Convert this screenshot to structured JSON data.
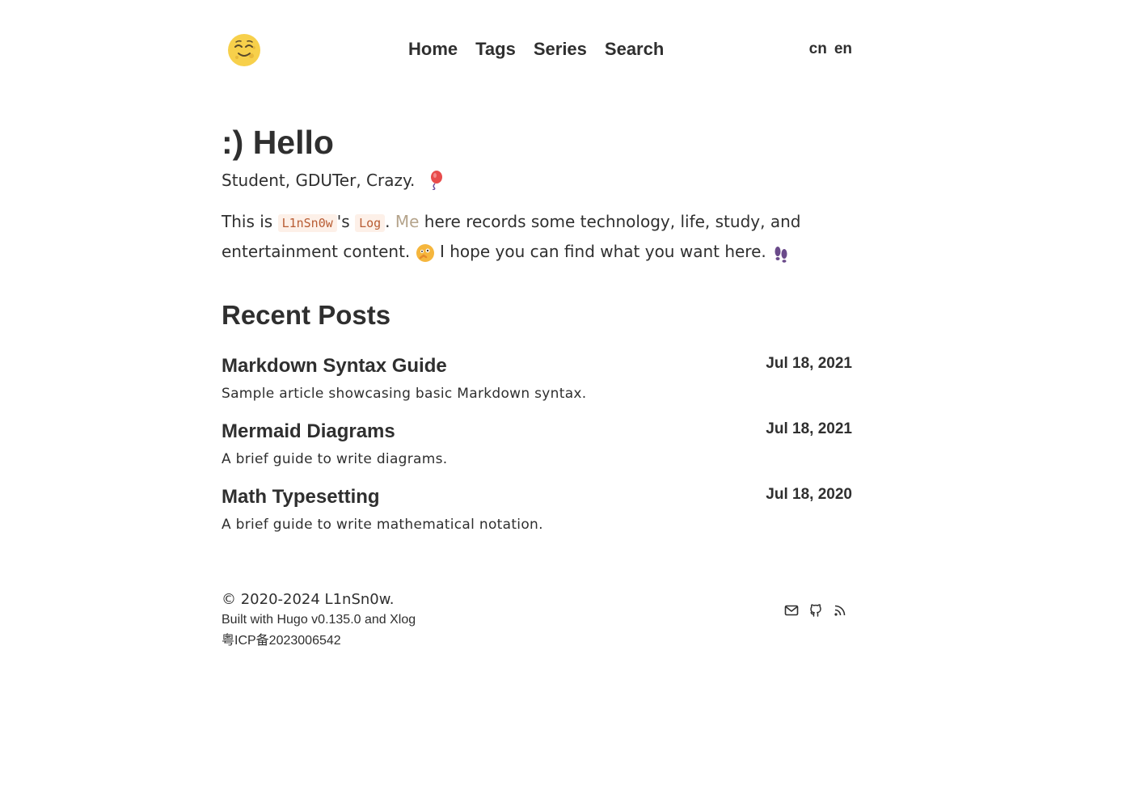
{
  "header": {
    "nav": [
      "Home",
      "Tags",
      "Series",
      "Search"
    ],
    "languages": [
      "cn",
      "en"
    ]
  },
  "hero": {
    "title": ":) Hello",
    "subtitle": "Student, GDUTer, Crazy.",
    "intro": {
      "part1": "This is ",
      "code1": "L1nSn0w",
      "part2": "'s ",
      "code2": "Log",
      "part3": ". ",
      "link": "Me",
      "part4": " here records some technology, life, study, and entertainment content.",
      "part5": " I hope you can find what you want here. "
    }
  },
  "recent": {
    "title": "Recent Posts",
    "posts": [
      {
        "title": "Markdown Syntax Guide",
        "date": "Jul 18, 2021",
        "desc": "Sample article showcasing basic Markdown syntax."
      },
      {
        "title": "Mermaid Diagrams",
        "date": "Jul 18, 2021",
        "desc": "A brief guide to write diagrams."
      },
      {
        "title": "Math Typesetting",
        "date": "Jul 18, 2020",
        "desc": "A brief guide to write mathematical notation."
      }
    ]
  },
  "footer": {
    "copyright": "© 2020-2024 L1nSn0w.",
    "built": "Built with Hugo v0.135.0 and Xlog",
    "icp": "粤ICP备2023006542"
  },
  "icons": [
    "smiling-moon-icon",
    "balloon-icon",
    "thinking-face-icon",
    "footprints-icon",
    "mail-icon",
    "github-icon",
    "rss-icon"
  ]
}
